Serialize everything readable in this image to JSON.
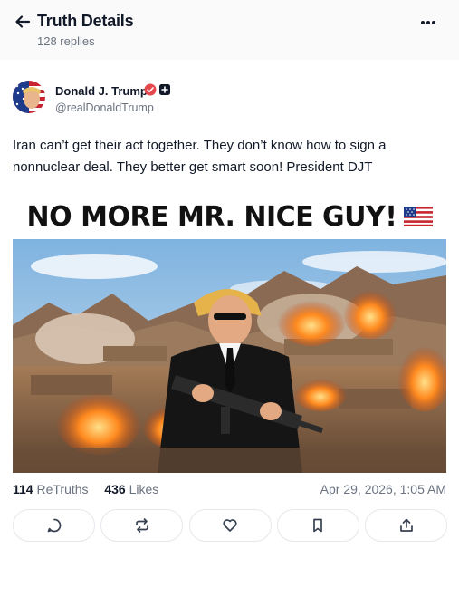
{
  "header": {
    "title": "Truth Details",
    "replies": "128 replies"
  },
  "post": {
    "author_name": "Donald J. Trump",
    "author_handle": "@realDonaldTrump",
    "text": "Iran can’t get their act together. They don’t know how to sign a nonnuclear deal. They better get smart soon! President DJT",
    "image_headline": "NO MORE MR. NICE GUY!",
    "retruths_count": "114",
    "retruths_label": "ReTruths",
    "likes_count": "436",
    "likes_label": "Likes",
    "timestamp": "Apr 29, 2026, 1:05 AM"
  },
  "actions": [
    {
      "icon": "reply-icon"
    },
    {
      "icon": "retruth-icon"
    },
    {
      "icon": "like-icon"
    },
    {
      "icon": "bookmark-icon"
    },
    {
      "icon": "share-icon"
    }
  ],
  "colors": {
    "verified_badge": "#e5484d",
    "accent": "#111827",
    "muted_text": "#6b7280"
  }
}
